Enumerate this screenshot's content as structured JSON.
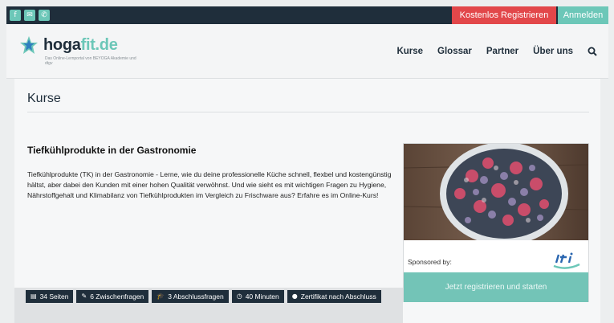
{
  "topbar": {
    "icons": [
      {
        "name": "facebook-icon",
        "glyph": "f"
      },
      {
        "name": "mail-icon",
        "glyph": "✉"
      },
      {
        "name": "phone-icon",
        "glyph": "✆"
      }
    ],
    "register_label": "Kostenlos Registrieren",
    "login_label": "Anmelden"
  },
  "header": {
    "logo_main": "hoga",
    "logo_accent": "fit.de",
    "logo_tagline": "Das Online-Lernportal von BEYOGA Akademie und dtgv",
    "nav": [
      "Kurse",
      "Glossar",
      "Partner",
      "Über uns"
    ]
  },
  "page": {
    "title": "Kurse"
  },
  "course": {
    "title": "Tiefkühlprodukte in der Gastronomie",
    "description": "Tiefkühlprodukte (TK) in der Gastronomie - Lerne, wie du deine professionelle Küche schnell, flexbel und kostengünstig hältst, aber dabei den Kunden mit einer hohen Qualität verwöhnst. Und wie sieht es mit wichtigen Fragen zu Hygiene, Nährstoffgehalt und Klimabilanz von Tiefkühlprodukten im Vergleich zu Frischware aus? Erfahre es im Online-Kurs!",
    "sponsor_label": "Sponsored by:",
    "cta_label": "Jetzt registrieren und starten",
    "tags": [
      {
        "icon": "document-icon",
        "glyph": "▤",
        "label": "34 Seiten"
      },
      {
        "icon": "edit-icon",
        "glyph": "✎",
        "label": "6 Zwischenfragen"
      },
      {
        "icon": "graduation-cap-icon",
        "glyph": "🎓",
        "label": "3 Abschlussfragen"
      },
      {
        "icon": "clock-icon",
        "glyph": "◷",
        "label": "40 Minuten"
      },
      {
        "icon": "certificate-icon",
        "glyph": "●",
        "label": "Zertifikat nach Abschluss"
      }
    ]
  },
  "colors": {
    "dark": "#1f2e3b",
    "accent": "#6cc7b8",
    "register": "#e2474a"
  }
}
